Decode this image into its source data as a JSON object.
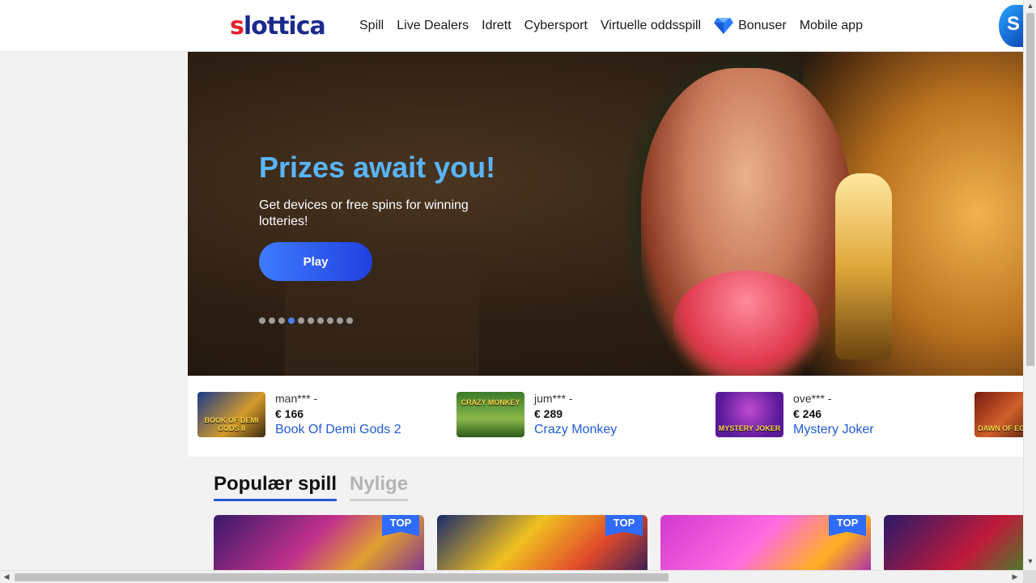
{
  "header": {
    "logo_s": "s",
    "logo_rest": "lottica",
    "nav": [
      {
        "label": "Spill"
      },
      {
        "label": "Live Dealers"
      },
      {
        "label": "Idrett"
      },
      {
        "label": "Cybersport"
      },
      {
        "label": "Virtuelle oddsspill"
      },
      {
        "label": "Bonuser",
        "icon": "diamond-icon"
      },
      {
        "label": "Mobile app"
      }
    ],
    "badge_letter": "S"
  },
  "hero": {
    "title": "Prizes await you!",
    "subtitle": "Get devices or free spins for winning lotteries!",
    "button": "Play",
    "slides_total": 10,
    "active_slide": 4,
    "colors": {
      "title": "#59b6ff",
      "button_start": "#3e7bff",
      "button_end": "#2040e0"
    }
  },
  "winners": [
    {
      "user": "man*** -",
      "amount": "€ 166",
      "game": "Book Of Demi Gods 2",
      "thumb_label": "BOOK OF DEMI GODS II"
    },
    {
      "user": "jum*** -",
      "amount": "€ 289",
      "game": "Crazy Monkey",
      "thumb_label": "CRAZY MONKEY"
    },
    {
      "user": "ove*** -",
      "amount": "€ 246",
      "game": "Mystery Joker",
      "thumb_label": "MYSTERY JOKER"
    },
    {
      "user": "",
      "amount": "",
      "game": "",
      "thumb_label": "DAWN OF EGYPT"
    }
  ],
  "popular": {
    "tabs": [
      {
        "label": "Populær spill",
        "active": true
      },
      {
        "label": "Nylige",
        "active": false
      }
    ],
    "cards": [
      {
        "badge": "TOP"
      },
      {
        "badge": "TOP"
      },
      {
        "badge": "TOP"
      },
      {
        "badge": ""
      }
    ]
  }
}
